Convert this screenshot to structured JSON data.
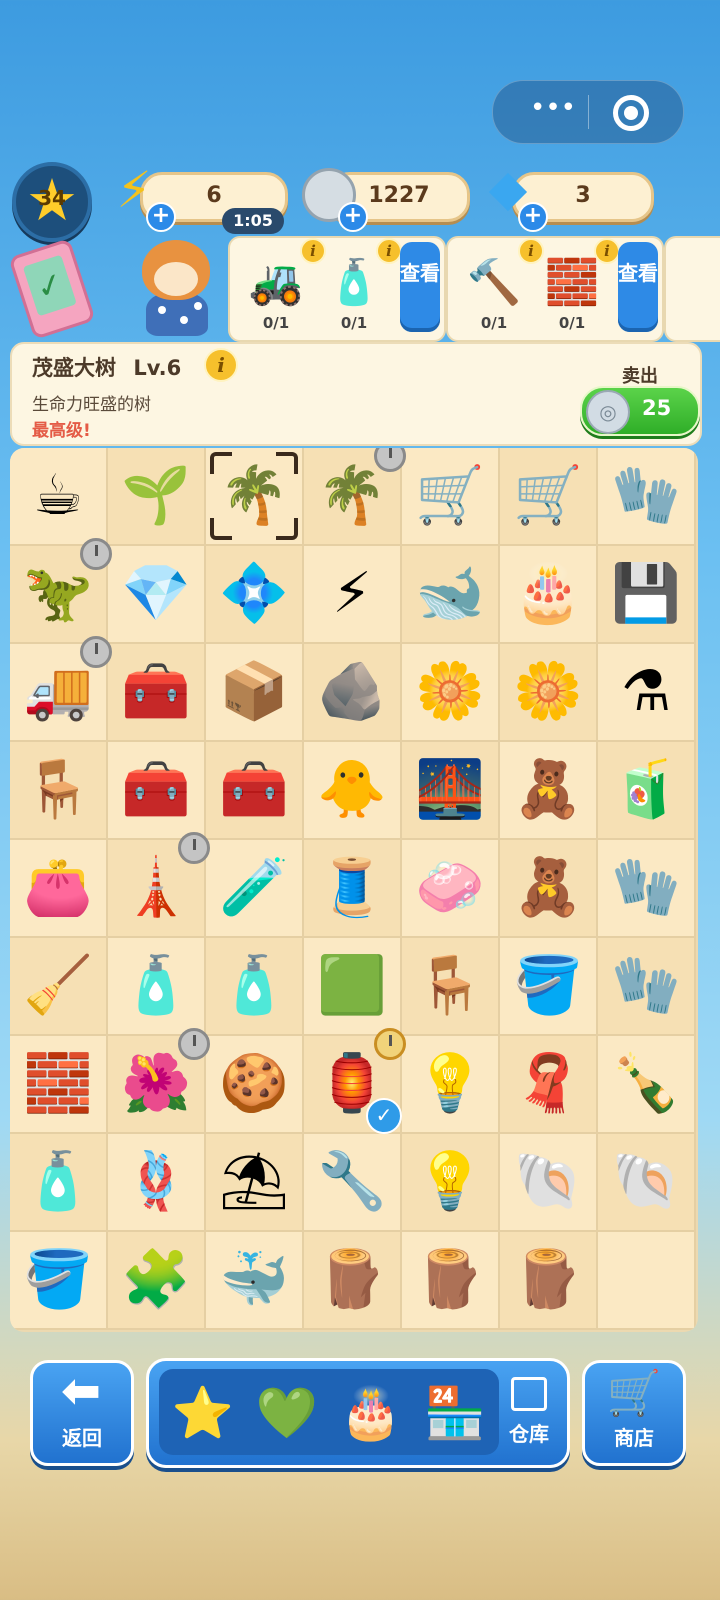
{
  "hud": {
    "level": "34",
    "energy": "6",
    "energy_timer": "1:05",
    "coins": "1227",
    "gems": "3"
  },
  "tasks": [
    {
      "items": [
        {
          "icon": "lawn-mower",
          "glyph": "🚜",
          "count": "0/1"
        },
        {
          "icon": "oil-bottle",
          "glyph": "🧴",
          "count": "0/1"
        }
      ],
      "button": "查看"
    },
    {
      "items": [
        {
          "icon": "hammer",
          "glyph": "🔨",
          "count": "0/1"
        },
        {
          "icon": "steel-pipes",
          "glyph": "🧱",
          "count": "0/1"
        }
      ],
      "button": "查看"
    }
  ],
  "info": {
    "name": "茂盛大树",
    "level": "Lv.6",
    "description": "生命力旺盛的树",
    "max_note": "最高级!",
    "sell_label": "卖出",
    "sell_price": "25"
  },
  "grid": [
    {
      "icon": "coffee-bean-sack",
      "glyph": "☕"
    },
    {
      "icon": "seed-bag",
      "glyph": "🌱"
    },
    {
      "icon": "lush-tree",
      "glyph": "🌴",
      "selected": true
    },
    {
      "icon": "sparkling-tree",
      "glyph": "🌴",
      "timer": true
    },
    {
      "icon": "cleaning-cart",
      "glyph": "🛒"
    },
    {
      "icon": "janitor-cart",
      "glyph": "🛒"
    },
    {
      "icon": "yellow-gloves",
      "glyph": "🧤"
    },
    {
      "icon": "dino-shelf",
      "glyph": "🦖",
      "timer": true
    },
    {
      "icon": "gem-necklace",
      "glyph": "💎"
    },
    {
      "icon": "blue-crystal",
      "glyph": "💠"
    },
    {
      "icon": "energy-sack",
      "glyph": "⚡"
    },
    {
      "icon": "whale-plush",
      "glyph": "🐋"
    },
    {
      "icon": "cake-stall",
      "glyph": "🎂"
    },
    {
      "icon": "usb-drive",
      "glyph": "💾"
    },
    {
      "icon": "toy-truck",
      "glyph": "🚚",
      "timer": true
    },
    {
      "icon": "tool-crate",
      "glyph": "🧰"
    },
    {
      "icon": "wood-crate",
      "glyph": "📦"
    },
    {
      "icon": "metal-sheets",
      "glyph": "🪨"
    },
    {
      "icon": "flower-planter",
      "glyph": "🌼"
    },
    {
      "icon": "flower-fence",
      "glyph": "🌼"
    },
    {
      "icon": "distiller",
      "glyph": "⚗"
    },
    {
      "icon": "wooden-chair",
      "glyph": "🪑"
    },
    {
      "icon": "blue-toolbox",
      "glyph": "🧰"
    },
    {
      "icon": "purple-toolbox",
      "glyph": "🧰"
    },
    {
      "icon": "duck-box",
      "glyph": "🐥"
    },
    {
      "icon": "arched-bridge",
      "glyph": "🌉"
    },
    {
      "icon": "toy-box",
      "glyph": "🧸"
    },
    {
      "icon": "detergent-box",
      "glyph": "🧃"
    },
    {
      "icon": "pink-wallet",
      "glyph": "👛"
    },
    {
      "icon": "lighthouse-toy",
      "glyph": "🗼",
      "timer": true
    },
    {
      "icon": "cancer-bottle",
      "glyph": "🧪"
    },
    {
      "icon": "thread-spools",
      "glyph": "🧵"
    },
    {
      "icon": "soap-bar",
      "glyph": "🧼"
    },
    {
      "icon": "teddy-bear",
      "glyph": "🧸"
    },
    {
      "icon": "yellow-gloves",
      "glyph": "🧤"
    },
    {
      "icon": "floor-mop",
      "glyph": "🧹"
    },
    {
      "icon": "spray-bottle",
      "glyph": "🧴"
    },
    {
      "icon": "laundry-detergent",
      "glyph": "🧴"
    },
    {
      "icon": "green-tiles",
      "glyph": "🟩"
    },
    {
      "icon": "wooden-stool",
      "glyph": "🪑"
    },
    {
      "icon": "paint-bucket",
      "glyph": "🪣"
    },
    {
      "icon": "yellow-gloves",
      "glyph": "🧤"
    },
    {
      "icon": "bricks",
      "glyph": "🧱"
    },
    {
      "icon": "flower-bush",
      "glyph": "🌺",
      "timer": true
    },
    {
      "icon": "bear-cookie",
      "glyph": "🍪"
    },
    {
      "icon": "bird-cage",
      "glyph": "🏮",
      "timer_gold": true,
      "checked": true
    },
    {
      "icon": "bulb-lamp",
      "glyph": "💡"
    },
    {
      "icon": "folded-towel",
      "glyph": "🧣"
    },
    {
      "icon": "leo-bottle",
      "glyph": "🍾"
    },
    {
      "icon": "pressure-sprayer",
      "glyph": "🧴"
    },
    {
      "icon": "rope-coil",
      "glyph": "🪢"
    },
    {
      "icon": "beach-umbrella",
      "glyph": "⛱"
    },
    {
      "icon": "trowel",
      "glyph": "🔧"
    },
    {
      "icon": "light-bulb",
      "glyph": "💡"
    },
    {
      "icon": "conch-shell",
      "glyph": "🐚"
    },
    {
      "icon": "scallop-shell",
      "glyph": "🐚"
    },
    {
      "icon": "cleaning-bucket",
      "glyph": "🪣"
    },
    {
      "icon": "yellow-brick-toy",
      "glyph": "🧩"
    },
    {
      "icon": "whale-pillow",
      "glyph": "🐳"
    },
    {
      "icon": "log-bundle",
      "glyph": "🪵"
    },
    {
      "icon": "log",
      "glyph": "🪵"
    },
    {
      "icon": "two-logs",
      "glyph": "🪵"
    },
    {
      "icon": "empty",
      "glyph": ""
    }
  ],
  "bottom": {
    "back_label": "返回",
    "storage_label": "仓库",
    "shop_label": "商店",
    "tray_items": [
      {
        "icon": "pisces-star",
        "glyph": "⭐"
      },
      {
        "icon": "leo-heart-bottle",
        "glyph": "💚"
      },
      {
        "icon": "ocean-cake",
        "glyph": "🎂"
      },
      {
        "icon": "market-stall",
        "glyph": "🏪"
      }
    ]
  }
}
